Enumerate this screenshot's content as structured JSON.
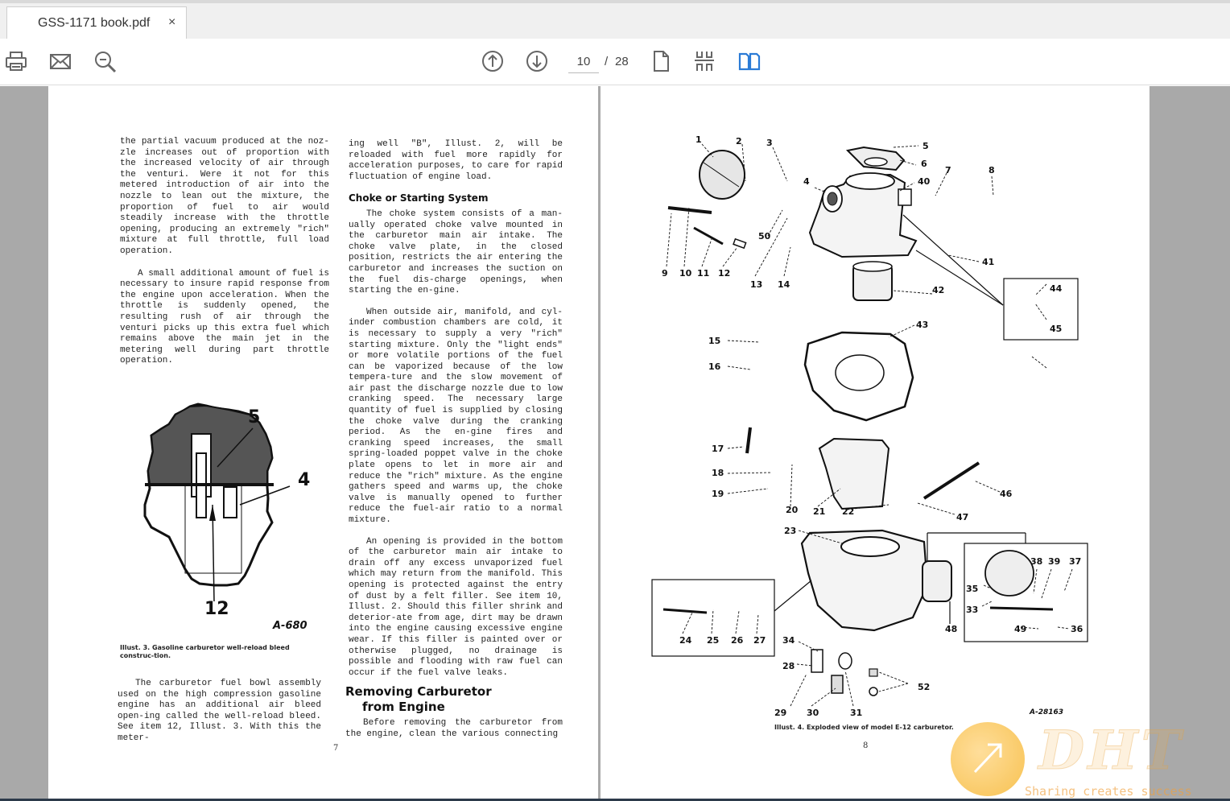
{
  "tab": {
    "title": "GSS-1171 book.pdf",
    "close": "×"
  },
  "toolbar": {
    "current_page": "10",
    "separator": "/",
    "total_pages": "28",
    "icons": [
      "print-icon",
      "email-icon",
      "zoom-icon",
      "page-up-icon",
      "page-down-icon",
      "single-page-icon",
      "thumbnails-icon",
      "two-page-icon"
    ],
    "accent_color": "#2b7bd6"
  },
  "left_page": {
    "col1": [
      "the partial vacuum produced at the noz-zle increases out of proportion with the increased velocity of air through the venturi.  Were it not for this metered introduction of air into the nozzle to lean out the mixture, the proportion of fuel to air would steadily increase with the throttle opening, producing an extremely \"rich\" mixture at full throttle, full load operation.",
      "A small additional amount of fuel is necessary to insure rapid response from the engine upon acceleration.  When the throttle is suddenly opened, the resulting rush of air through the venturi picks up this extra fuel which remains above the main jet in the metering well during part throttle operation."
    ],
    "figure_labels": {
      "a": "5",
      "b": "4",
      "c": "12"
    },
    "figure_code": "A-680",
    "caption": "Illust. 3.  Gasoline carburetor well-reload bleed construc-tion.",
    "col1_bottom": "The carburetor fuel bowl assembly used on the high compression gasoline engine has an additional air bleed open-ing called the well-reload bleed.  See item 12, Illust. 3.  With this the meter-",
    "col2_top": "ing well \"B\", Illust. 2, will be reloaded with fuel more rapidly for acceleration purposes, to care for rapid fluctuation of engine load.",
    "heading_choke": "Choke or Starting System",
    "col2_p1": "The choke system consists of a man-ually operated choke valve mounted in the carburetor main air intake.  The choke valve plate, in the closed position, restricts the air entering the carburetor and increases the suction on the fuel dis-charge openings, when starting the en-gine.",
    "col2_p2": "When outside air, manifold, and cyl-inder combustion chambers are cold, it is necessary to supply a very \"rich\" starting mixture.  Only the \"light ends\" or more volatile portions of the fuel can be vaporized because of the low tempera-ture and the slow movement of air past the discharge nozzle due to low cranking speed.  The necessary large quantity of fuel is supplied by closing the choke valve during the cranking period.  As the en-gine fires and cranking speed increases, the small spring-loaded poppet valve in the choke plate opens to let in more air and reduce the \"rich\" mixture.  As the engine gathers speed and warms up, the choke valve is manually opened to further reduce the fuel-air ratio to a normal mixture.",
    "col2_p3": "An opening is provided in the bottom of the carburetor main air intake to drain off any excess unvaporized fuel which may return from the manifold.  This opening is protected against the entry of dust by a felt filler.  See item 10, Illust. 2.  Should this filler shrink and deterior-ate from age, dirt may be drawn into the engine causing excessive engine wear.  If this filler is painted over or otherwise plugged, no drainage is possible and flooding with raw fuel can occur if the fuel valve leaks.",
    "heading_remove_1": "Removing Carburetor",
    "heading_remove_2": "from Engine",
    "col2_p4": "Before removing the carburetor from the engine, clean the various connecting",
    "page_number": "7"
  },
  "right_page": {
    "figure_code": "A-28163",
    "caption": "Illust. 4.  Exploded view of model E-12 carburetor.",
    "page_number": "8",
    "part_numbers": [
      "1",
      "2",
      "3",
      "4",
      "5",
      "6",
      "7",
      "8",
      "9",
      "10",
      "11",
      "12",
      "13",
      "14",
      "15",
      "16",
      "17",
      "18",
      "19",
      "20",
      "21",
      "22",
      "23",
      "24",
      "25",
      "26",
      "27",
      "28",
      "29",
      "30",
      "31",
      "33",
      "34",
      "35",
      "36",
      "37",
      "38",
      "39",
      "40",
      "41",
      "42",
      "43",
      "44",
      "45",
      "46",
      "47",
      "48",
      "49",
      "50",
      "52"
    ]
  },
  "watermark": {
    "logo": "DHT",
    "tagline": "Sharing creates success"
  }
}
